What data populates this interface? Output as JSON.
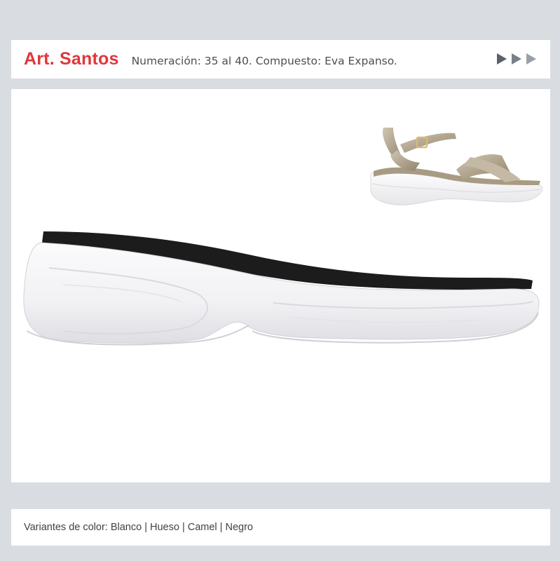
{
  "header": {
    "title": "Art. Santos",
    "subtitle": "Numeración: 35 al 40. Compuesto: Eva Expanso.",
    "nav_icons": [
      "play-arrow-icon",
      "play-arrow-icon",
      "play-arrow-icon"
    ]
  },
  "footer": {
    "variants_text": "Variantes de color: Blanco | Hueso | Camel | Negro"
  },
  "colors": {
    "title_red": "#e2363a",
    "background": "#d9dde2",
    "sole_white": "#f4f4f6",
    "insole_black": "#1c1c1c",
    "sandal_metallic": "#b6ab98"
  }
}
